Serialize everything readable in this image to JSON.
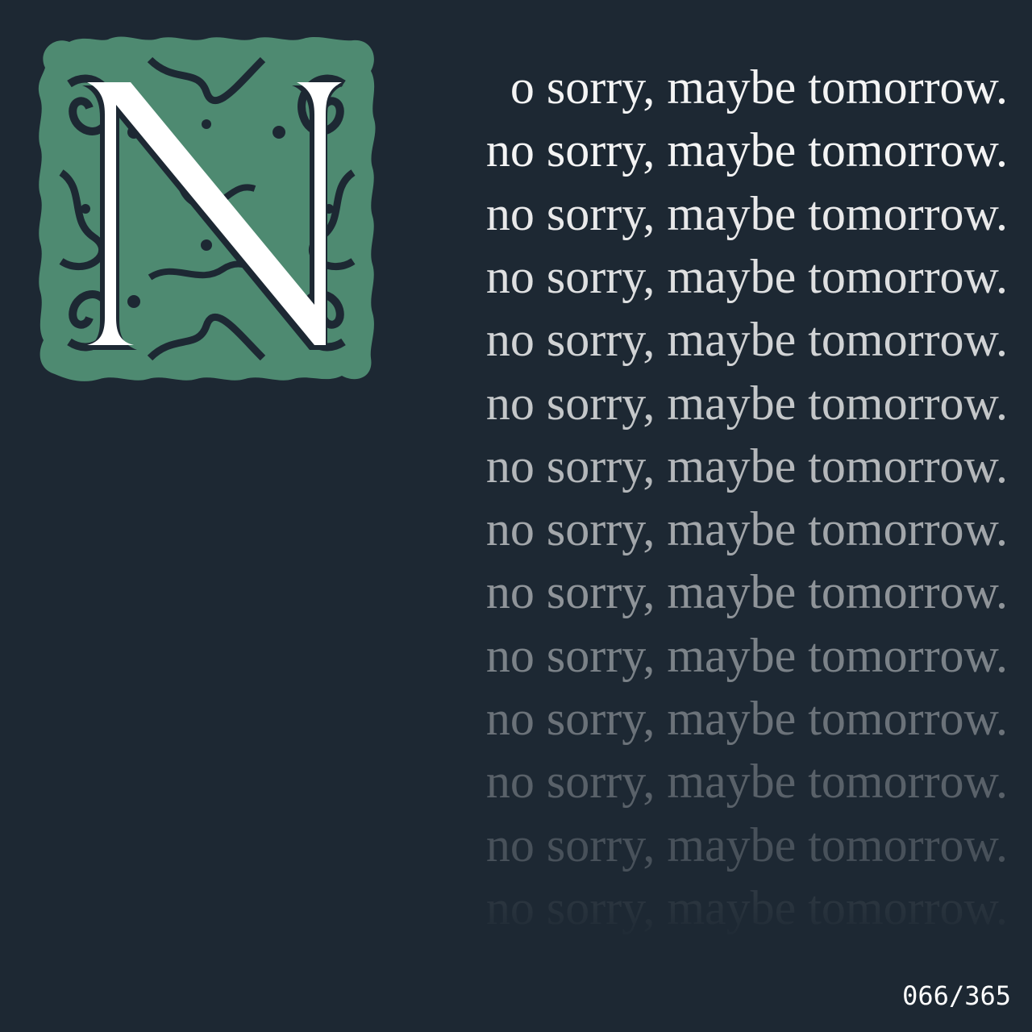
{
  "repeated_line": {
    "text": "no sorry, maybe tomorrow.",
    "first_line_text": "o sorry, maybe tomorrow.",
    "count": 14,
    "opacities": [
      1.0,
      1.0,
      0.95,
      0.9,
      0.84,
      0.78,
      0.7,
      0.62,
      0.53,
      0.44,
      0.36,
      0.28,
      0.2,
      0.11
    ]
  },
  "initial": {
    "letter": "N",
    "ornament_color": "#4e8a71",
    "letter_color": "#ffffff"
  },
  "counter": {
    "text": "066/365"
  },
  "colors": {
    "background": "#1d2833",
    "text": "#f4f4f4"
  }
}
